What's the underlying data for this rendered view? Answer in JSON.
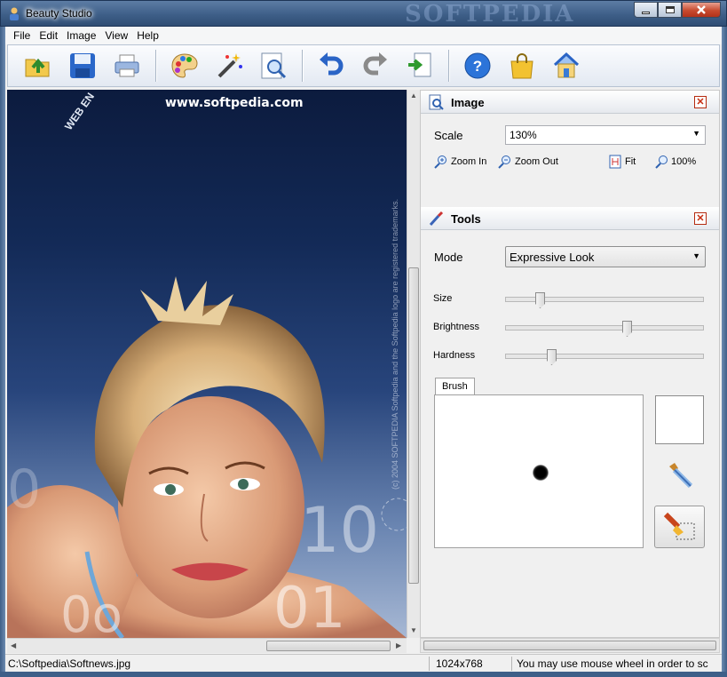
{
  "window": {
    "title": "Beauty Studio",
    "watermark": "SOFTPEDIA"
  },
  "menu": [
    "File",
    "Edit",
    "Image",
    "View",
    "Help"
  ],
  "toolbar": {
    "buttons": [
      "open-icon",
      "save-icon",
      "print-icon",
      "palette-icon",
      "magic-wand-icon",
      "zoom-preview-icon",
      "undo-icon",
      "redo-icon",
      "export-icon",
      "help-icon",
      "shop-icon",
      "home-icon"
    ]
  },
  "canvas": {
    "url_text": "www.softpedia.com",
    "vertical_text": "(c) 2004  SOFTPEDIA  Softpedia and the Softpedia logo are registered trademarks.",
    "arc_text": "WEB  EN"
  },
  "image_panel": {
    "title": "Image",
    "scale_label": "Scale",
    "scale_value": "130%",
    "zoom_in": "Zoom In",
    "zoom_out": "Zoom Out",
    "fit": "Fit",
    "full": "100%"
  },
  "tools_panel": {
    "title": "Tools",
    "mode_label": "Mode",
    "mode_value": "Expressive Look",
    "sliders": [
      {
        "label": "Size",
        "value": 0.16
      },
      {
        "label": "Brightness",
        "value": 0.62
      },
      {
        "label": "Hardness",
        "value": 0.22
      }
    ],
    "brush_tab": "Brush"
  },
  "status": {
    "path": "C:\\Softpedia\\Softnews.jpg",
    "dimensions": "1024x768",
    "hint": "You may use mouse wheel in order to sc"
  },
  "colors": {
    "accent": "#3e5f88",
    "close": "#c62d0f"
  }
}
